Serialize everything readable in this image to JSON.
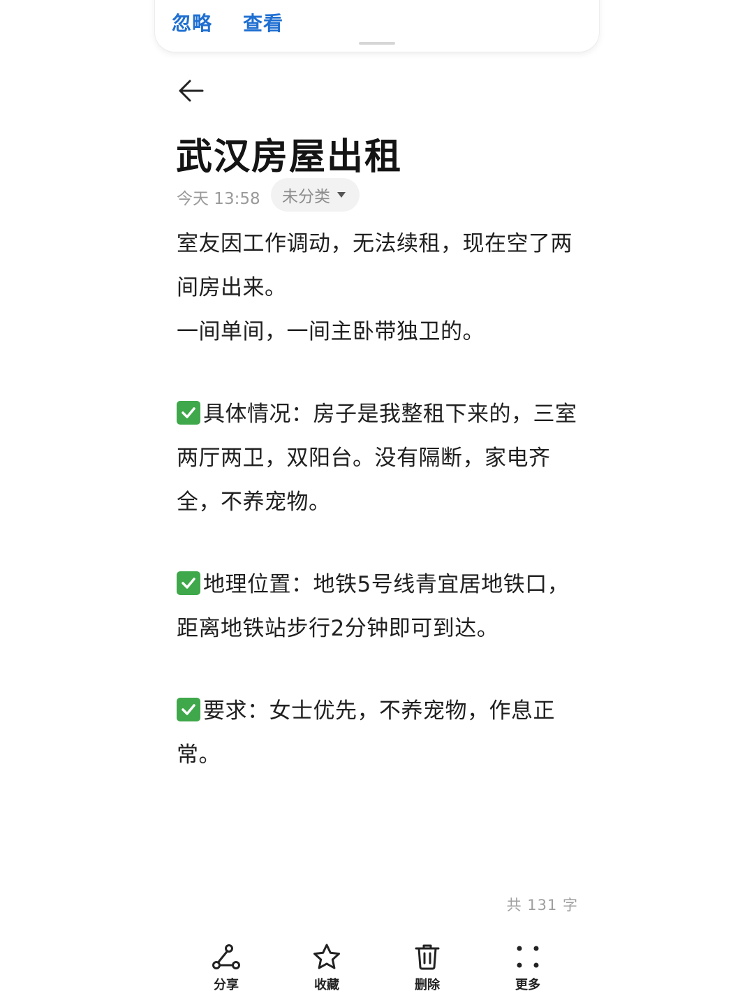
{
  "banner": {
    "ignore_label": "忽略",
    "view_label": "查看"
  },
  "note": {
    "title": "武汉房屋出租",
    "time": "今天 13:58",
    "category": "未分类",
    "paragraphs": [
      [
        "室友因工作调动，无法续租，现在空了两间房出来。",
        "一间单间，一间主卧带独卫的。"
      ],
      [
        "具体情况：房子是我整租下来的，三室两厅两卫，双阳台。没有隔断，家电齐全，不养宠物。"
      ],
      [
        "地理位置：地铁5号线青宜居地铁口，距离地铁站步行2分钟即可到达。"
      ],
      [
        "要求：女士优先，不养宠物，作息正常。"
      ]
    ],
    "word_count": "共 131 字"
  },
  "toolbar": {
    "share_label": "分享",
    "favorite_label": "收藏",
    "delete_label": "删除",
    "more_label": "更多"
  },
  "colors": {
    "accent": "#1f6fd1",
    "check": "#3fa84a"
  }
}
